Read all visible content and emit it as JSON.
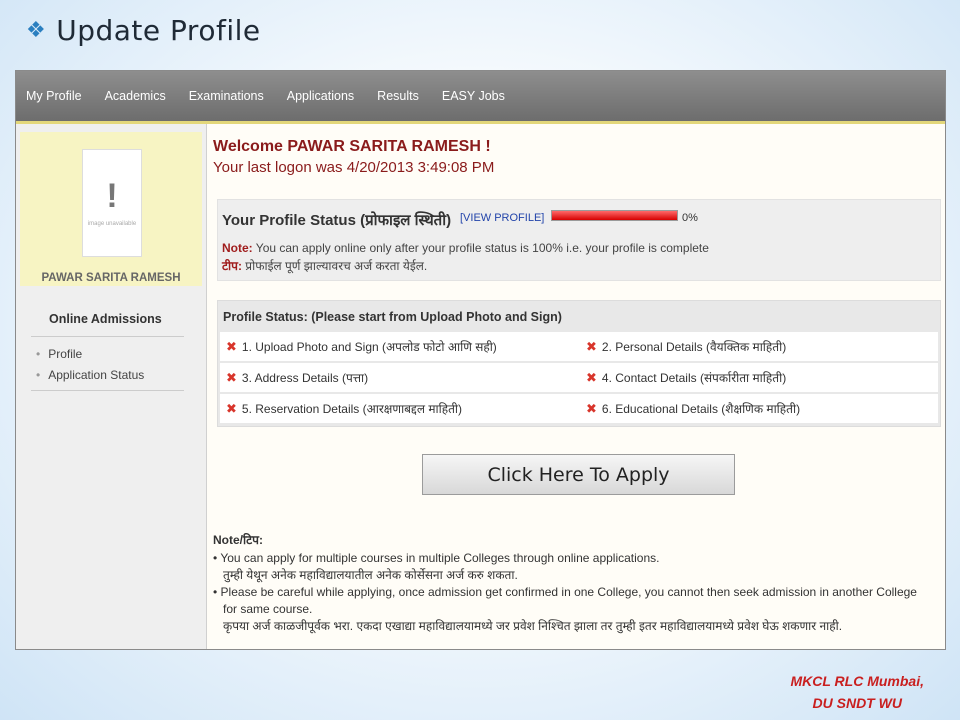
{
  "slide": {
    "title": "Update Profile",
    "bullet_icon": "diamond-bullet-icon"
  },
  "nav": [
    "My Profile",
    "Academics",
    "Examinations",
    "Applications",
    "Results",
    "EASY Jobs"
  ],
  "sidebar": {
    "avatar_caption": "image unavailable",
    "name": "PAWAR SARITA RAMESH",
    "heading": "Online Admissions",
    "items": [
      "Profile",
      "Application Status"
    ]
  },
  "welcome": {
    "greeting": "Welcome PAWAR SARITA RAMESH !",
    "last_logon": "Your last logon was 4/20/2013 3:49:08 PM"
  },
  "profile_status": {
    "title": "Your Profile Status (प्रोफाइल स्थिती)",
    "view_link": "[VIEW PROFILE]",
    "percent_label": "0%",
    "note_label": "Note:",
    "note_text": " You can apply online only after your profile status is 100% i.e. your profile is complete",
    "tip_label": "टीप:",
    "tip_text": " प्रोफाईल पूर्ण झाल्यावरच अर्ज करता येईल."
  },
  "steps": {
    "heading": "Profile Status: (Please start from Upload Photo and Sign)",
    "items": [
      "1. Upload Photo and Sign (अपलोड फोटो आणि सही)",
      "2. Personal Details (वैयक्तिक माहिती)",
      "3. Address Details (पत्ता)",
      "4. Contact Details (संपर्कारीता माहिती)",
      "5. Reservation Details (आरक्षणाबद्दल माहिती)",
      "6. Educational Details (शैक्षणिक माहिती)"
    ]
  },
  "apply_button": "Click Here To Apply",
  "bottom_notes": {
    "heading": "Note/टिप:",
    "line1": "You can apply for multiple courses in multiple Colleges through online applications.",
    "line1_mr": "तुम्ही येथून अनेक महाविद्यालयातील अनेक कोर्सेसना अर्ज करु शकता.",
    "line2": "Please be careful while applying, once admission get confirmed in one College, you cannot then seek admission in another College",
    "line2b": "for same course.",
    "line2_mr": "कृपया अर्ज काळजीपूर्वक भरा. एकदा एखाद्या महाविद्यालयामध्ये जर प्रवेश निश्चित झाला तर तुम्ही इतर महाविद्यालयामध्ये प्रवेश घेऊ शकणार नाही."
  },
  "footer": {
    "line1": "MKCL RLC Mumbai,",
    "line2": "DU SNDT WU"
  },
  "colors": {
    "accent_red": "#8a1b1b",
    "progress_red": "#d60000",
    "nav_bg": "#7a7a7a",
    "link_blue": "#2244aa"
  }
}
